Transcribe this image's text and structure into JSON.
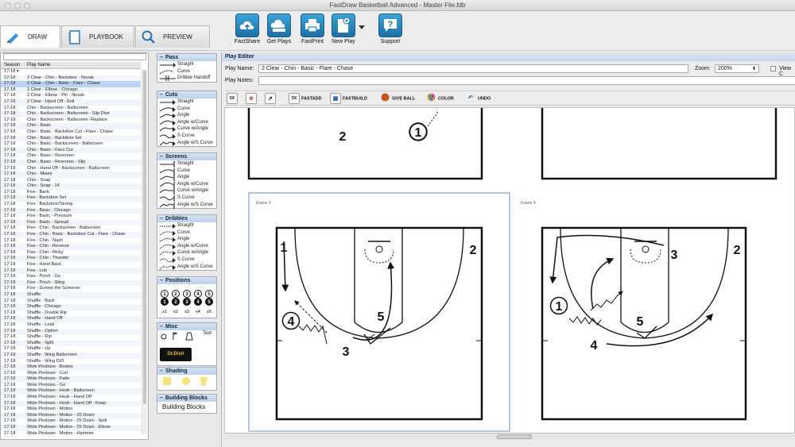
{
  "window": {
    "title": "FastDraw Basketball Advanced - Master File.fdb"
  },
  "tabs": [
    {
      "label": "DRAW",
      "active": true
    },
    {
      "label": "PLAYBOOK"
    },
    {
      "label": "PREVIEW"
    }
  ],
  "toolbar": [
    {
      "label": "FastShare"
    },
    {
      "label": "Get Plays"
    },
    {
      "label": "FastPrint"
    },
    {
      "label": "New Play"
    },
    {
      "label": "Support"
    }
  ],
  "playlist": {
    "headers": {
      "season": "Season",
      "name": "Play Name"
    },
    "filter": "17-18",
    "rows": [
      [
        "17-18",
        "2 Clear - Chin - Backdoor - Novak"
      ],
      [
        "17-18",
        "2 Clear - Chin - Basic - Flare - Chase"
      ],
      [
        "17-18",
        "2 Clear - Elbow - Chicago"
      ],
      [
        "17-18",
        "2 Clear - Elbow - Pin - Novak"
      ],
      [
        "17-18",
        "2 Clear - Hand Off - Exit"
      ],
      [
        "17-18",
        "Chin - Backscreen - Ballscreen"
      ],
      [
        "17-18",
        "Chin - Backscreen - Ballscreen - Slip Dive"
      ],
      [
        "17-18",
        "Chin - Backscreen - Ballscreen -Replace"
      ],
      [
        "17-18",
        "Chin - Basic"
      ],
      [
        "17-18",
        "Chin - Basic - Backdoor Cut - Flare - Chase"
      ],
      [
        "17-18",
        "Chin - Basic - Backdoor Set"
      ],
      [
        "17-18",
        "Chin - Basic - Backscreen - Ballscreen"
      ],
      [
        "17-18",
        "Chin - Basic - Face Cut"
      ],
      [
        "17-18",
        "Chin - Basic - Rescreen"
      ],
      [
        "17-18",
        "Chin - Basic - Rescreen - Slip"
      ],
      [
        "17-18",
        "Chin - Hand Off - Backscreen - Ballscreen"
      ],
      [
        "17-18",
        "Chin - Miami"
      ],
      [
        "17-18",
        "Chin - Snap"
      ],
      [
        "17-18",
        "Chin - Snap - 14"
      ],
      [
        "17-18",
        "Five - Back"
      ],
      [
        "17-18",
        "Five - Backdoor Set"
      ],
      [
        "17-18",
        "Five - Backdoor/Strong"
      ],
      [
        "17-18",
        "Five - Basic - Chicago"
      ],
      [
        "17-18",
        "Five - Basic - Pressure"
      ],
      [
        "17-18",
        "Five - Basic - Spread"
      ],
      [
        "17-18",
        "Five - Chin - Backscreen - Ballscreen"
      ],
      [
        "17-18",
        "Five - Chin - Basic - Backdoor Cut - Flare - Chase"
      ],
      [
        "17-18",
        "Five - Chin - Nash"
      ],
      [
        "17-18",
        "Five - Chin - Reverse"
      ],
      [
        "17-18",
        "Five - Chin - Ricky"
      ],
      [
        "17-18",
        "Five - Chin - Thunder"
      ],
      [
        "17-18",
        "Five - Hand Back"
      ],
      [
        "17-18",
        "Five - Lob"
      ],
      [
        "17-18",
        "Five - Pinch - Go"
      ],
      [
        "17-18",
        "Five - Pinch - Sting"
      ],
      [
        "17-18",
        "Five - Screen the Screener"
      ],
      [
        "17-18",
        "Shuffle"
      ],
      [
        "17-18",
        "Shuffle - Back"
      ],
      [
        "17-18",
        "Shuffle - Chicago"
      ],
      [
        "17-18",
        "Shuffle - Double Rip"
      ],
      [
        "17-18",
        "Shuffle - Hand Off"
      ],
      [
        "17-18",
        "Shuffle - Leak"
      ],
      [
        "17-18",
        "Shuffle - Option"
      ],
      [
        "17-18",
        "Shuffle - Rip"
      ],
      [
        "17-18",
        "Shuffle - Split"
      ],
      [
        "17-18",
        "Shuffle - Up"
      ],
      [
        "17-18",
        "Shuffle - Wing Ballscreen"
      ],
      [
        "17-18",
        "Shuffle - Wing ISO"
      ],
      [
        "17-18",
        "Wide Pindown - Boston"
      ],
      [
        "17-18",
        "Wide Pindown - Curl"
      ],
      [
        "17-18",
        "Wide Pindown - Fade"
      ],
      [
        "17-18",
        "Wide Pindown - Go"
      ],
      [
        "17-18",
        "Wide Pindown - Hook - Ballscreen"
      ],
      [
        "17-18",
        "Wide Pindown - Hook - Hand Off"
      ],
      [
        "17-18",
        "Wide Pindown - Hook - Hand Off - Keep"
      ],
      [
        "17-18",
        "Wide Pindown - Motion"
      ],
      [
        "17-18",
        "Wide Pindown - Motion - 25 Down"
      ],
      [
        "17-18",
        "Wide Pindown - Motion - 25 Down - Split"
      ],
      [
        "17-18",
        "Wide Pindown - Motion - 25 Down - Elbow"
      ],
      [
        "17-18",
        "Wide Pindown - Motion - Hammer"
      ]
    ],
    "selected": 1
  },
  "tools": {
    "pass": {
      "title": "Pass",
      "items": [
        "Straight",
        "Curve",
        "Dribble Handoff"
      ]
    },
    "cuts": {
      "title": "Cuts",
      "items": [
        "Straight",
        "Curve",
        "Angle",
        "Angle w/Curve",
        "Curve w/Angle",
        "S Curve",
        "Angle w/S Curve"
      ]
    },
    "screens": {
      "title": "Screens",
      "items": [
        "Straight",
        "Curve",
        "Angle",
        "Angle w/Curve",
        "Curve w/Angle",
        "S Curve",
        "Angle w/S Curve"
      ]
    },
    "dribbles": {
      "title": "Dribbles",
      "items": [
        "Straight",
        "Curve",
        "Angle",
        "Angle w/Curve",
        "Curve w/Angle",
        "S Curve",
        "Angle w/S Curve"
      ]
    },
    "positions": {
      "title": "Positions",
      "nums": [
        "1",
        "2",
        "3",
        "4",
        "5"
      ],
      "x": [
        "x1",
        "x2",
        "x3",
        "x4",
        "x5"
      ]
    },
    "misc": {
      "title": "Misc",
      "text_label": "Text",
      "logo": "Dr.Dish"
    },
    "shading": {
      "title": "Shading"
    },
    "blocks": {
      "title": "Building Blocks",
      "label": "Building Blocks"
    }
  },
  "editor": {
    "title": "Play Editor",
    "play_name_label": "Play Name:",
    "play_name": "2 Clear - Chin - Basic - Flare - Chase",
    "notes_label": "Play Notes:",
    "zoom_label": "Zoom:",
    "zoom": "200%",
    "view_label": "View C",
    "buttons": {
      "fastadd": "FASTADD",
      "fastbuild": "FASTBUILD",
      "giveball": "GIVE BALL",
      "color": "COLOR",
      "undo": "UNDO",
      "five_x": "5X"
    },
    "frames": [
      {
        "label": "Frame 3"
      },
      {
        "label": "Frame 4"
      }
    ],
    "players": {
      "f1_2": "2",
      "f1_1": "1",
      "f3_1": "1",
      "f3_2": "2",
      "f3_4": "4",
      "f3_3": "3",
      "f3_5": "5",
      "f4_3": "3",
      "f4_2": "2",
      "f4_1": "1",
      "f4_5": "5",
      "f4_4": "4"
    }
  }
}
